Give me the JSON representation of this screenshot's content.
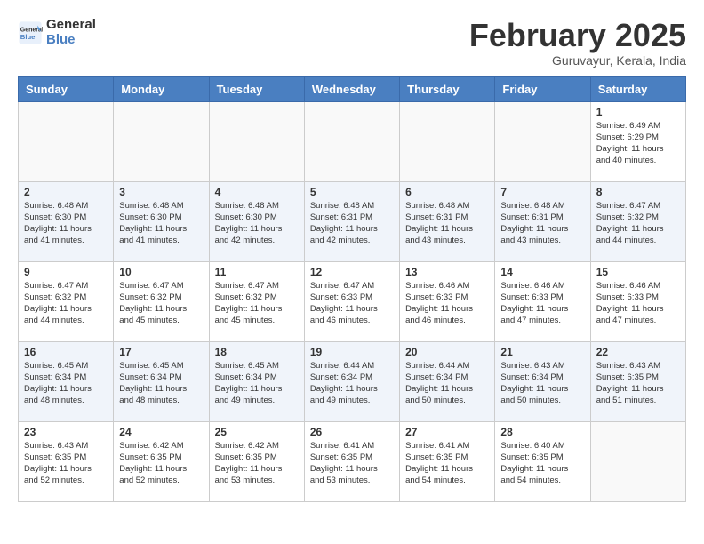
{
  "header": {
    "logo_line1": "General",
    "logo_line2": "Blue",
    "month": "February 2025",
    "location": "Guruvayur, Kerala, India"
  },
  "weekdays": [
    "Sunday",
    "Monday",
    "Tuesday",
    "Wednesday",
    "Thursday",
    "Friday",
    "Saturday"
  ],
  "weeks": [
    [
      {
        "day": "",
        "info": ""
      },
      {
        "day": "",
        "info": ""
      },
      {
        "day": "",
        "info": ""
      },
      {
        "day": "",
        "info": ""
      },
      {
        "day": "",
        "info": ""
      },
      {
        "day": "",
        "info": ""
      },
      {
        "day": "1",
        "info": "Sunrise: 6:49 AM\nSunset: 6:29 PM\nDaylight: 11 hours\nand 40 minutes."
      }
    ],
    [
      {
        "day": "2",
        "info": "Sunrise: 6:48 AM\nSunset: 6:30 PM\nDaylight: 11 hours\nand 41 minutes."
      },
      {
        "day": "3",
        "info": "Sunrise: 6:48 AM\nSunset: 6:30 PM\nDaylight: 11 hours\nand 41 minutes."
      },
      {
        "day": "4",
        "info": "Sunrise: 6:48 AM\nSunset: 6:30 PM\nDaylight: 11 hours\nand 42 minutes."
      },
      {
        "day": "5",
        "info": "Sunrise: 6:48 AM\nSunset: 6:31 PM\nDaylight: 11 hours\nand 42 minutes."
      },
      {
        "day": "6",
        "info": "Sunrise: 6:48 AM\nSunset: 6:31 PM\nDaylight: 11 hours\nand 43 minutes."
      },
      {
        "day": "7",
        "info": "Sunrise: 6:48 AM\nSunset: 6:31 PM\nDaylight: 11 hours\nand 43 minutes."
      },
      {
        "day": "8",
        "info": "Sunrise: 6:47 AM\nSunset: 6:32 PM\nDaylight: 11 hours\nand 44 minutes."
      }
    ],
    [
      {
        "day": "9",
        "info": "Sunrise: 6:47 AM\nSunset: 6:32 PM\nDaylight: 11 hours\nand 44 minutes."
      },
      {
        "day": "10",
        "info": "Sunrise: 6:47 AM\nSunset: 6:32 PM\nDaylight: 11 hours\nand 45 minutes."
      },
      {
        "day": "11",
        "info": "Sunrise: 6:47 AM\nSunset: 6:32 PM\nDaylight: 11 hours\nand 45 minutes."
      },
      {
        "day": "12",
        "info": "Sunrise: 6:47 AM\nSunset: 6:33 PM\nDaylight: 11 hours\nand 46 minutes."
      },
      {
        "day": "13",
        "info": "Sunrise: 6:46 AM\nSunset: 6:33 PM\nDaylight: 11 hours\nand 46 minutes."
      },
      {
        "day": "14",
        "info": "Sunrise: 6:46 AM\nSunset: 6:33 PM\nDaylight: 11 hours\nand 47 minutes."
      },
      {
        "day": "15",
        "info": "Sunrise: 6:46 AM\nSunset: 6:33 PM\nDaylight: 11 hours\nand 47 minutes."
      }
    ],
    [
      {
        "day": "16",
        "info": "Sunrise: 6:45 AM\nSunset: 6:34 PM\nDaylight: 11 hours\nand 48 minutes."
      },
      {
        "day": "17",
        "info": "Sunrise: 6:45 AM\nSunset: 6:34 PM\nDaylight: 11 hours\nand 48 minutes."
      },
      {
        "day": "18",
        "info": "Sunrise: 6:45 AM\nSunset: 6:34 PM\nDaylight: 11 hours\nand 49 minutes."
      },
      {
        "day": "19",
        "info": "Sunrise: 6:44 AM\nSunset: 6:34 PM\nDaylight: 11 hours\nand 49 minutes."
      },
      {
        "day": "20",
        "info": "Sunrise: 6:44 AM\nSunset: 6:34 PM\nDaylight: 11 hours\nand 50 minutes."
      },
      {
        "day": "21",
        "info": "Sunrise: 6:43 AM\nSunset: 6:34 PM\nDaylight: 11 hours\nand 50 minutes."
      },
      {
        "day": "22",
        "info": "Sunrise: 6:43 AM\nSunset: 6:35 PM\nDaylight: 11 hours\nand 51 minutes."
      }
    ],
    [
      {
        "day": "23",
        "info": "Sunrise: 6:43 AM\nSunset: 6:35 PM\nDaylight: 11 hours\nand 52 minutes."
      },
      {
        "day": "24",
        "info": "Sunrise: 6:42 AM\nSunset: 6:35 PM\nDaylight: 11 hours\nand 52 minutes."
      },
      {
        "day": "25",
        "info": "Sunrise: 6:42 AM\nSunset: 6:35 PM\nDaylight: 11 hours\nand 53 minutes."
      },
      {
        "day": "26",
        "info": "Sunrise: 6:41 AM\nSunset: 6:35 PM\nDaylight: 11 hours\nand 53 minutes."
      },
      {
        "day": "27",
        "info": "Sunrise: 6:41 AM\nSunset: 6:35 PM\nDaylight: 11 hours\nand 54 minutes."
      },
      {
        "day": "28",
        "info": "Sunrise: 6:40 AM\nSunset: 6:35 PM\nDaylight: 11 hours\nand 54 minutes."
      },
      {
        "day": "",
        "info": ""
      }
    ]
  ]
}
